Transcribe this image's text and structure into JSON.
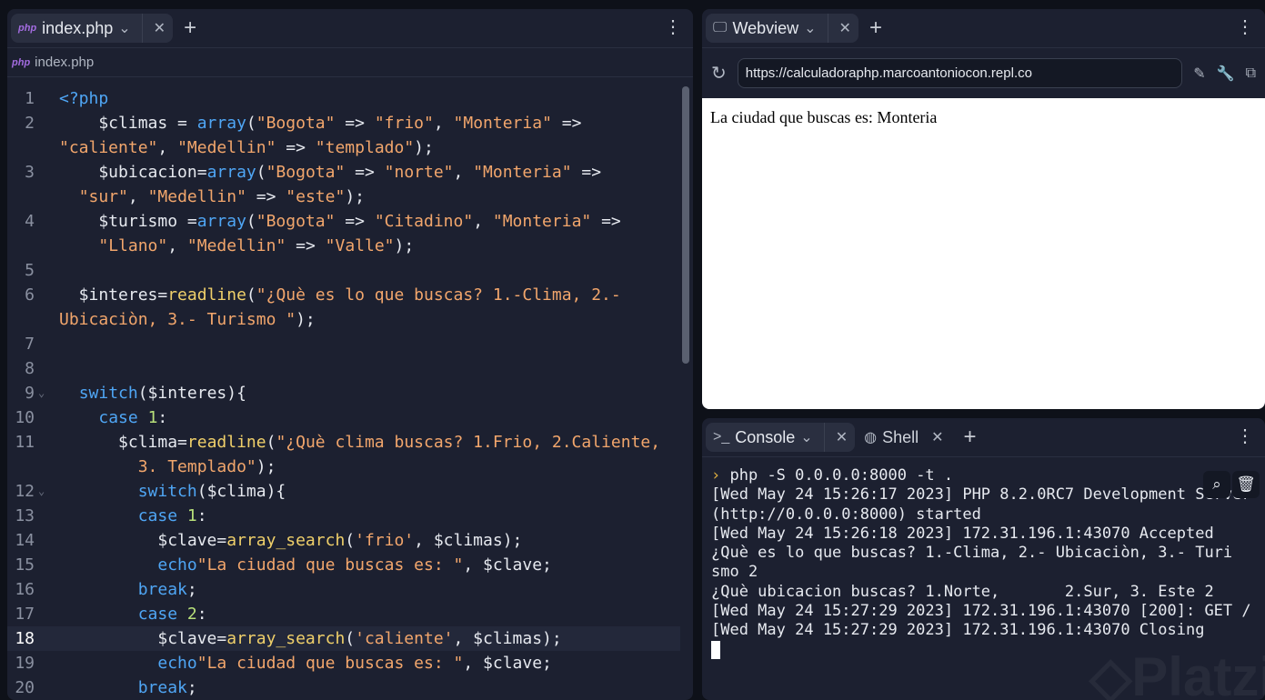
{
  "editor": {
    "tab_label": "index.php",
    "file_icon": "php",
    "breadcrumb": "index.php",
    "rows": [
      {
        "n": "1",
        "c": [
          [
            "k",
            "<?php"
          ]
        ]
      },
      {
        "n": "2",
        "c": [
          [
            "t",
            "    $climas = "
          ],
          [
            "k",
            "array"
          ],
          [
            "t",
            "("
          ],
          [
            "s",
            "\"Bogota\""
          ],
          [
            "t",
            " => "
          ],
          [
            "s",
            "\"frio\""
          ],
          [
            "t",
            ", "
          ],
          [
            "s",
            "\"Monteria\""
          ],
          [
            "t",
            " =>"
          ]
        ]
      },
      {
        "n": "",
        "c": [
          [
            "s",
            "\"caliente\""
          ],
          [
            "t",
            ", "
          ],
          [
            "s",
            "\"Medellin\""
          ],
          [
            "t",
            " => "
          ],
          [
            "s",
            "\"templado\""
          ],
          [
            "t",
            ");"
          ]
        ]
      },
      {
        "n": "3",
        "c": [
          [
            "t",
            "    $ubicacion="
          ],
          [
            "k",
            "array"
          ],
          [
            "t",
            "("
          ],
          [
            "s",
            "\"Bogota\""
          ],
          [
            "t",
            " => "
          ],
          [
            "s",
            "\"norte\""
          ],
          [
            "t",
            ", "
          ],
          [
            "s",
            "\"Monteria\""
          ],
          [
            "t",
            " =>"
          ]
        ]
      },
      {
        "n": "",
        "c": [
          [
            "t",
            "  "
          ],
          [
            "s",
            "\"sur\""
          ],
          [
            "t",
            ", "
          ],
          [
            "s",
            "\"Medellin\""
          ],
          [
            "t",
            " => "
          ],
          [
            "s",
            "\"este\""
          ],
          [
            "t",
            ");"
          ]
        ]
      },
      {
        "n": "4",
        "c": [
          [
            "t",
            "    $turismo ="
          ],
          [
            "k",
            "array"
          ],
          [
            "t",
            "("
          ],
          [
            "s",
            "\"Bogota\""
          ],
          [
            "t",
            " => "
          ],
          [
            "s",
            "\"Citadino\""
          ],
          [
            "t",
            ", "
          ],
          [
            "s",
            "\"Monteria\""
          ],
          [
            "t",
            " =>"
          ]
        ]
      },
      {
        "n": "",
        "c": [
          [
            "t",
            "    "
          ],
          [
            "s",
            "\"Llano\""
          ],
          [
            "t",
            ", "
          ],
          [
            "s",
            "\"Medellin\""
          ],
          [
            "t",
            " => "
          ],
          [
            "s",
            "\"Valle\""
          ],
          [
            "t",
            ");"
          ]
        ]
      },
      {
        "n": "5",
        "c": []
      },
      {
        "n": "6",
        "c": [
          [
            "t",
            "  $interes="
          ],
          [
            "f",
            "readline"
          ],
          [
            "t",
            "("
          ],
          [
            "s",
            "\"¿Què es lo que buscas? 1.-Clima, 2.-"
          ]
        ]
      },
      {
        "n": "",
        "c": [
          [
            "s",
            "Ubicaciòn, 3.- Turismo \""
          ],
          [
            "t",
            ");"
          ]
        ]
      },
      {
        "n": "7",
        "c": []
      },
      {
        "n": "8",
        "c": []
      },
      {
        "n": "9",
        "fold": true,
        "c": [
          [
            "t",
            "  "
          ],
          [
            "k",
            "switch"
          ],
          [
            "t",
            "($interes){"
          ]
        ]
      },
      {
        "n": "10",
        "c": [
          [
            "t",
            "    "
          ],
          [
            "k",
            "case"
          ],
          [
            "t",
            " "
          ],
          [
            "n",
            "1"
          ],
          [
            "t",
            ":"
          ]
        ]
      },
      {
        "n": "11",
        "c": [
          [
            "t",
            "      $clima="
          ],
          [
            "f",
            "readline"
          ],
          [
            "t",
            "("
          ],
          [
            "s",
            "\"¿Què clima buscas? 1.Frio, 2.Caliente,"
          ]
        ]
      },
      {
        "n": "",
        "c": [
          [
            "t",
            "        "
          ],
          [
            "s",
            "3. Templado\""
          ],
          [
            "t",
            ");"
          ]
        ]
      },
      {
        "n": "12",
        "fold": true,
        "c": [
          [
            "t",
            "        "
          ],
          [
            "k",
            "switch"
          ],
          [
            "t",
            "($clima){"
          ]
        ]
      },
      {
        "n": "13",
        "c": [
          [
            "t",
            "        "
          ],
          [
            "k",
            "case"
          ],
          [
            "t",
            " "
          ],
          [
            "n",
            "1"
          ],
          [
            "t",
            ":"
          ]
        ]
      },
      {
        "n": "14",
        "c": [
          [
            "t",
            "          $clave="
          ],
          [
            "f",
            "array_search"
          ],
          [
            "t",
            "("
          ],
          [
            "s",
            "'frio'"
          ],
          [
            "t",
            ", $climas);"
          ]
        ]
      },
      {
        "n": "15",
        "c": [
          [
            "t",
            "          "
          ],
          [
            "k",
            "echo"
          ],
          [
            "s",
            "\"La ciudad que buscas es: \""
          ],
          [
            "t",
            ", $clave;"
          ]
        ]
      },
      {
        "n": "16",
        "c": [
          [
            "t",
            "        "
          ],
          [
            "k",
            "break"
          ],
          [
            "t",
            ";"
          ]
        ]
      },
      {
        "n": "17",
        "c": [
          [
            "t",
            "        "
          ],
          [
            "k",
            "case"
          ],
          [
            "t",
            " "
          ],
          [
            "n",
            "2"
          ],
          [
            "t",
            ":"
          ]
        ]
      },
      {
        "n": "18",
        "hl": true,
        "c": [
          [
            "t",
            "          $clave="
          ],
          [
            "f",
            "array_search"
          ],
          [
            "t",
            "("
          ],
          [
            "s",
            "'caliente'"
          ],
          [
            "t",
            ", $climas);"
          ]
        ]
      },
      {
        "n": "19",
        "c": [
          [
            "t",
            "          "
          ],
          [
            "k",
            "echo"
          ],
          [
            "s",
            "\"La ciudad que buscas es: \""
          ],
          [
            "t",
            ", $clave;"
          ]
        ]
      },
      {
        "n": "20",
        "c": [
          [
            "t",
            "        "
          ],
          [
            "k",
            "break"
          ],
          [
            "t",
            ";"
          ]
        ]
      }
    ]
  },
  "webview": {
    "tab_label": "Webview",
    "url": "https://calculadoraphp.marcoantoniocon.repl.co",
    "page_text": "La ciudad que buscas es: Monteria"
  },
  "console": {
    "tab_label": "Console",
    "shell_label": "Shell",
    "command": "php -S 0.0.0.0:8000 -t .",
    "output": "[Wed May 24 15:26:17 2023] PHP 8.2.0RC7 Development Server\n(http://0.0.0.0:8000) started\n[Wed May 24 15:26:18 2023] 172.31.196.1:43070 Accepted\n¿Què es lo que buscas? 1.-Clima, 2.- Ubicaciòn, 3.- Turi\nsmo 2\n¿Què ubicacion buscas? 1.Norte,       2.Sur, 3. Este 2\n[Wed May 24 15:27:29 2023] 172.31.196.1:43070 [200]: GET /\n[Wed May 24 15:27:29 2023] 172.31.196.1:43070 Closing"
  },
  "watermark": "Platzi"
}
